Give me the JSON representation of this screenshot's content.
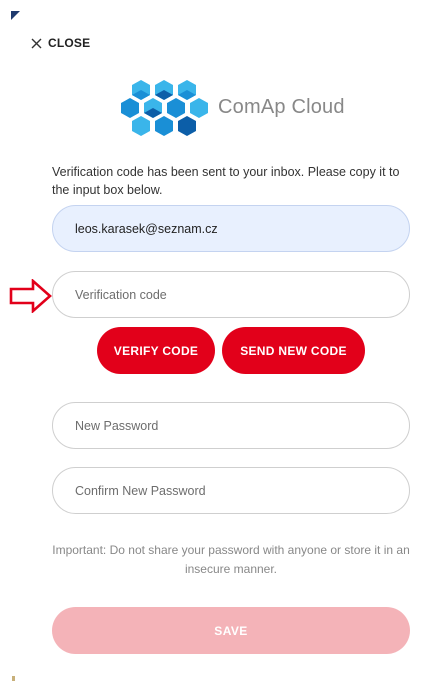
{
  "header": {
    "close_label": "CLOSE",
    "close_icon": "close-icon"
  },
  "brand": {
    "logo_icon": "comap-cube-logo-icon",
    "name": "ComAp Cloud",
    "colors": [
      "#1a8fd6",
      "#3ab5ea",
      "#0c5ea8"
    ]
  },
  "message": "Verification code has been sent to your inbox. Please copy it to the input box below.",
  "form": {
    "email_value": "leos.karasek@seznam.cz",
    "verification_placeholder": "Verification code",
    "verify_button": "VERIFY CODE",
    "send_new_button": "SEND NEW CODE",
    "new_password_placeholder": "New Password",
    "confirm_password_placeholder": "Confirm New Password",
    "note": "Important: Do not share your password with anyone or store it in an insecure manner.",
    "save_button": "SAVE"
  },
  "annotation": {
    "arrow_icon": "right-arrow-icon",
    "arrow_color": "#e2001a"
  },
  "colors": {
    "accent": "#e2001a",
    "save_disabled": "#f4b3b8",
    "autofill_bg": "#e8f0fe"
  }
}
